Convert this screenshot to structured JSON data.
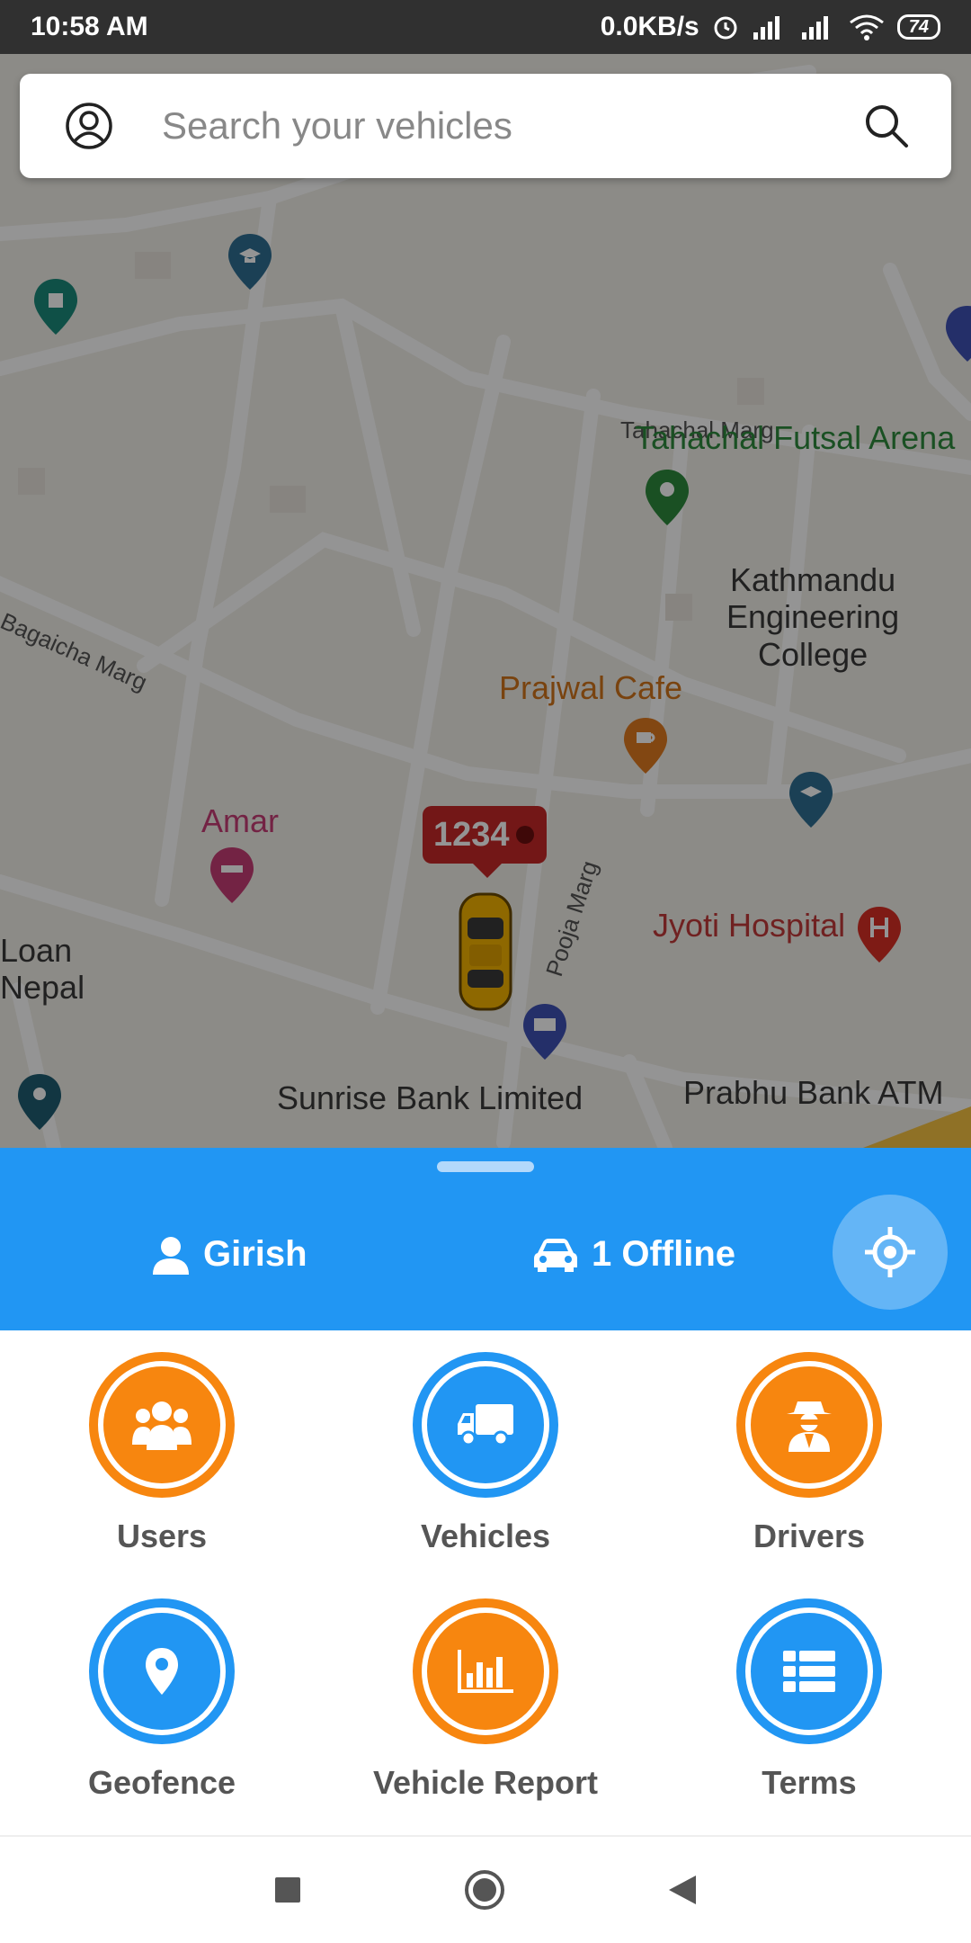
{
  "status_bar": {
    "time": "10:58 AM",
    "network_speed": "0.0KB/s",
    "battery": "74"
  },
  "search": {
    "placeholder": "Search your vehicles"
  },
  "map": {
    "places": {
      "futsal": "Tahachal Futsal Arena",
      "street_tahachal": "Tahachal Marg",
      "college": "Kathmandu\nEngineering\nCollege",
      "cafe": "Prajwal Cafe",
      "amar": "Amar",
      "bagaicha": "Bagaicha Marg",
      "pooja": "Pooja Marg",
      "hospital": "Jyoti Hospital",
      "loan": "Loan\nNepal",
      "sunrise": "Sunrise Bank Limited",
      "prabhu": "Prabhu Bank ATM"
    },
    "vehicle_tag": "1234"
  },
  "panel": {
    "user_name": "Girish",
    "vehicle_status": "1 Offline"
  },
  "menu": {
    "users": "Users",
    "vehicles": "Vehicles",
    "drivers": "Drivers",
    "geofence": "Geofence",
    "vehicle_report": "Vehicle Report",
    "terms": "Terms"
  },
  "colors": {
    "accent_blue": "#2196f3",
    "accent_orange": "#f7860f"
  }
}
